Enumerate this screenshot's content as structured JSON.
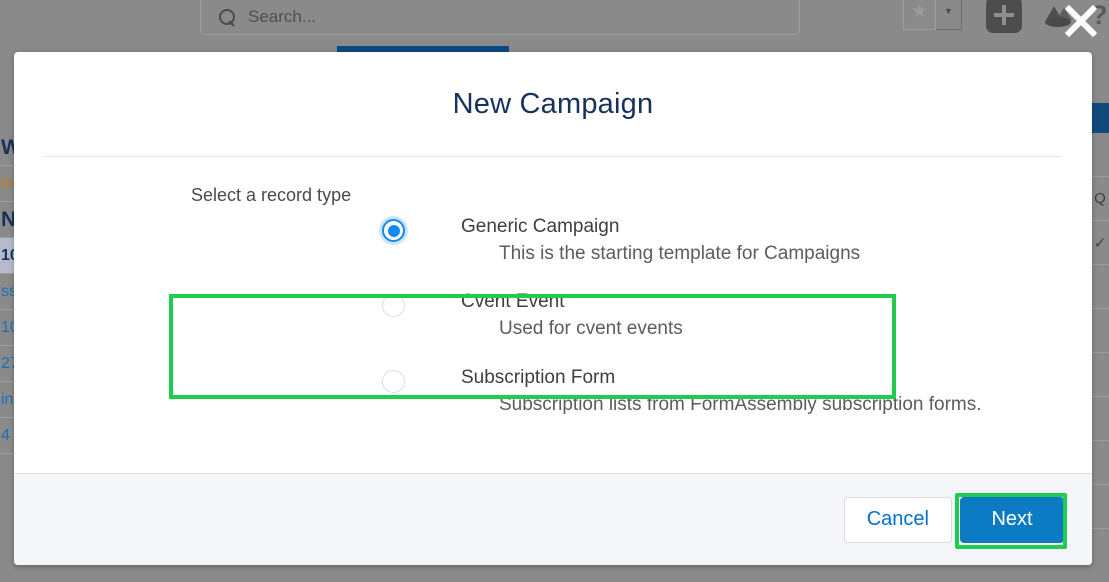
{
  "background": {
    "search": {
      "placeholder": "Search...",
      "icon": "search-icon"
    },
    "icons": {
      "favorites": "star-icon",
      "favorites_caret": "chevron-down-icon",
      "add": "plus-icon",
      "app_logo": "app-logo-icon",
      "help": "question-mark-icon"
    },
    "table_left_fragments": [
      "W",
      "in",
      "N",
      "10",
      "ss",
      "10",
      "27",
      "in",
      "4"
    ],
    "right_column_fragments": [
      "Q",
      "✓"
    ]
  },
  "modal": {
    "title": "New Campaign",
    "record_type": {
      "legend": "Select a record type",
      "options": [
        {
          "label": "Generic Campaign",
          "description": "This is the starting template for Campaigns",
          "selected": true
        },
        {
          "label": "Cvent Event",
          "description": "Used for cvent events",
          "selected": false
        },
        {
          "label": "Subscription Form",
          "description": "Subscription lists from FormAssembly subscription forms.",
          "selected": false
        }
      ]
    },
    "footer": {
      "cancel_label": "Cancel",
      "next_label": "Next"
    }
  },
  "annotations": {
    "color": "#1fcc4d",
    "targets": [
      "record-type-fieldset",
      "next-button"
    ]
  },
  "cursor": {
    "type": "close-x-cursor"
  },
  "colors": {
    "accent_blue": "#0d7ac4",
    "radio_blue": "#1589ee",
    "link_blue": "#0070d2",
    "title_navy": "#16325c",
    "footer_bg": "#f4f6f9",
    "annotation_green": "#1fcc4d",
    "overlay_gray": "#8a8a8a"
  }
}
